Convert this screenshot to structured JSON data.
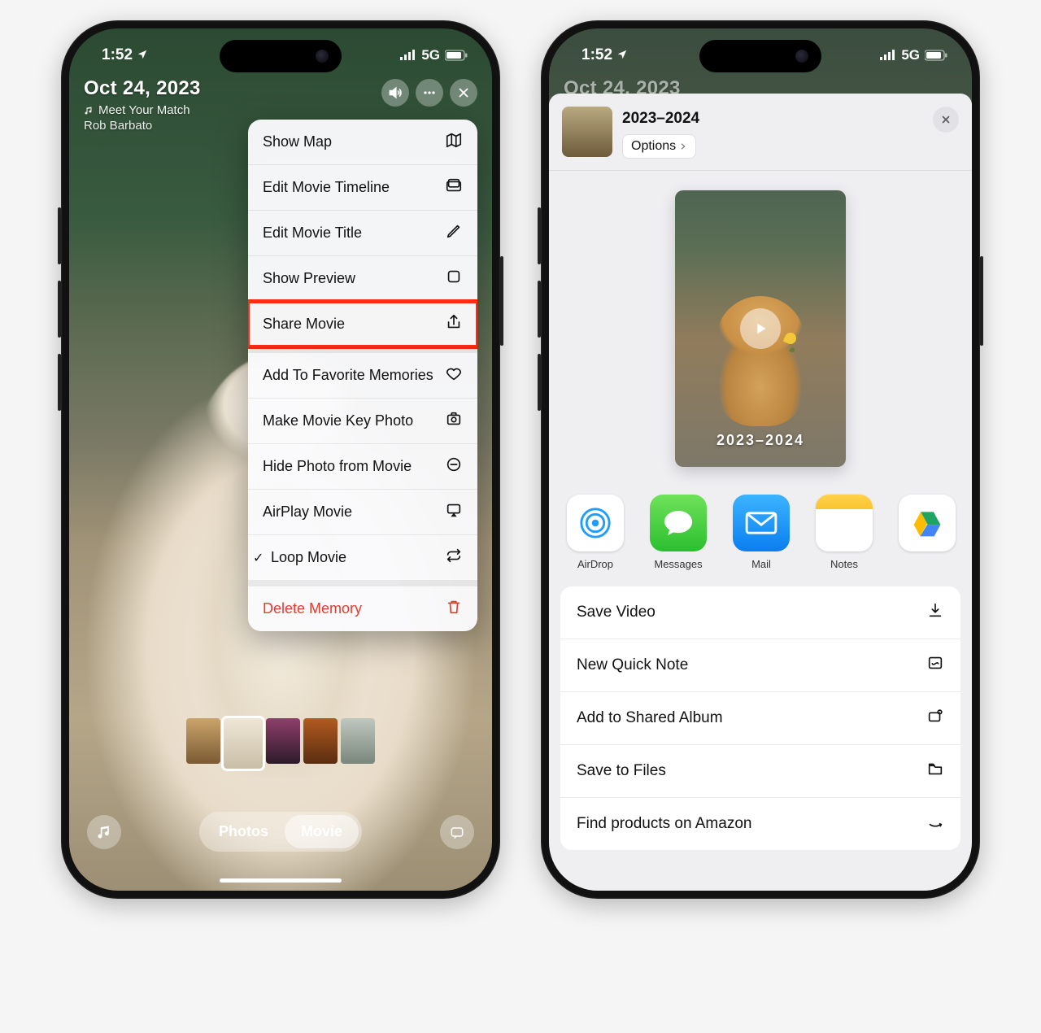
{
  "status": {
    "time": "1:52",
    "network": "5G"
  },
  "left": {
    "date": "Oct 24, 2023",
    "song": "Meet Your Match",
    "artist": "Rob Barbato",
    "tabs": {
      "photos": "Photos",
      "movie": "Movie"
    },
    "menu": [
      {
        "label": "Show Map",
        "icon": "map"
      },
      {
        "label": "Edit Movie Timeline",
        "icon": "timeline"
      },
      {
        "label": "Edit Movie Title",
        "icon": "pencil"
      },
      {
        "label": "Show Preview",
        "icon": "square"
      },
      {
        "label": "Share Movie",
        "icon": "share",
        "highlight": true
      },
      {
        "label": "Add To Favorite Memories",
        "icon": "heart",
        "section": true
      },
      {
        "label": "Make Movie Key Photo",
        "icon": "keyphoto"
      },
      {
        "label": "Hide Photo from Movie",
        "icon": "minuscircle"
      },
      {
        "label": "AirPlay Movie",
        "icon": "airplay"
      },
      {
        "label": "Loop Movie",
        "icon": "loop",
        "checked": true
      },
      {
        "label": "Delete Memory",
        "icon": "trash",
        "danger": true,
        "section": true
      }
    ]
  },
  "right": {
    "date": "Oct 24, 2023",
    "share_title": "2023–2024",
    "options": "Options",
    "preview_caption": "2023–2024",
    "apps": [
      {
        "label": "AirDrop",
        "style": "ai-airdrop",
        "glyph": "airdrop"
      },
      {
        "label": "Messages",
        "style": "ai-msg",
        "glyph": "bubble"
      },
      {
        "label": "Mail",
        "style": "ai-mail",
        "glyph": "envelope"
      },
      {
        "label": "Notes",
        "style": "ai-notes",
        "glyph": ""
      },
      {
        "label": "",
        "style": "ai-drive",
        "glyph": "drive"
      }
    ],
    "actions": [
      {
        "label": "Save Video",
        "icon": "download"
      },
      {
        "label": "New Quick Note",
        "icon": "quicknote"
      },
      {
        "label": "Add to Shared Album",
        "icon": "sharedalbum"
      },
      {
        "label": "Save to Files",
        "icon": "folder"
      },
      {
        "label": "Find products on Amazon",
        "icon": "amazon"
      }
    ]
  }
}
